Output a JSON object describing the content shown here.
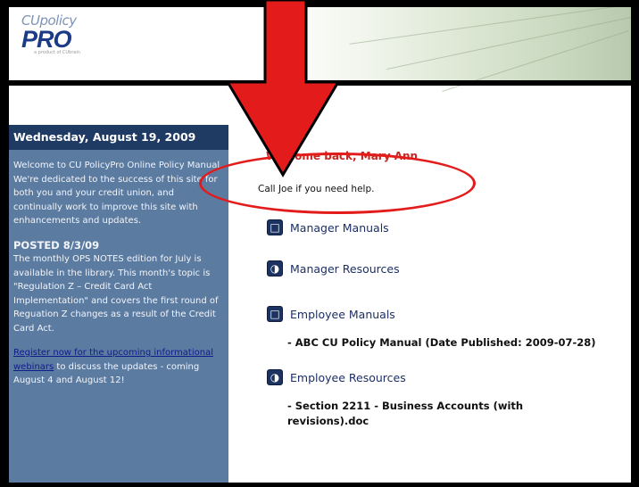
{
  "header": {
    "logo_top": "CUpolicy",
    "logo_main": "PRO",
    "logo_tag": "a product of CUbrain"
  },
  "sidebar": {
    "date": "Wednesday, August 19, 2009",
    "intro": "Welcome to CU PolicyPro Online Policy Manual. We're dedicated to the success of this site for both you and your credit union, and continually work to improve this site with enhancements and updates.",
    "posted_title": "POSTED 8/3/09",
    "posted_body": "The monthly OPS NOTES edition for July is available in the library. This month's topic is \"Regulation Z – Credit Card Act Implementation\" and covers the first round of Reguation Z changes as a result of the Credit Card Act.",
    "register_link": "Register now for the upcoming informational webinars",
    "register_rest": " to discuss the updates - coming August 4 and August 12!"
  },
  "main": {
    "welcome": "Welcome back, Mary Ann",
    "help": "Call Joe if you need help.",
    "sections": [
      {
        "label": "Manager Manuals",
        "icon": "manual-icon",
        "items": []
      },
      {
        "label": "Manager Resources",
        "icon": "resource-icon",
        "items": []
      },
      {
        "label": "Employee Manuals",
        "icon": "manual-icon",
        "items": [
          "- ABC CU Policy Manual (Date Published: 2009-07-28)"
        ]
      },
      {
        "label": "Employee Resources",
        "icon": "resource-icon",
        "items": [
          "- Section 2211 - Business Accounts (with revisions).doc"
        ]
      }
    ]
  },
  "annotation": {
    "arrow_color": "#e31b1b",
    "oval_color": "#e31b1b"
  }
}
